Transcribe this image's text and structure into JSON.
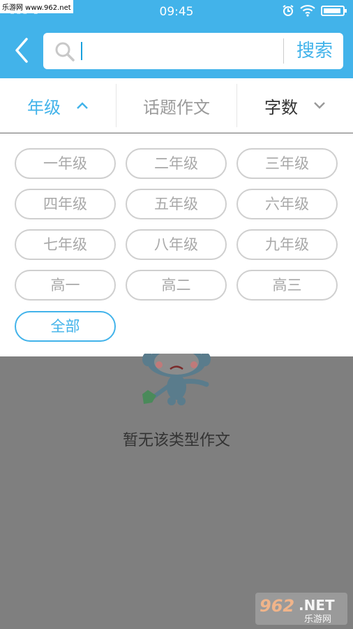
{
  "status_bar": {
    "time": "09:45",
    "signal_text": "",
    "watermark": "乐游网 www.962.net"
  },
  "header": {
    "search": {
      "placeholder": "",
      "value": "",
      "button_label": "搜索"
    }
  },
  "filter_tabs": [
    {
      "label": "年级",
      "active": true
    },
    {
      "label": "话题作文",
      "active": false
    },
    {
      "label": "字数",
      "active": false
    }
  ],
  "grades": [
    {
      "label": "一年级",
      "selected": false
    },
    {
      "label": "二年级",
      "selected": false
    },
    {
      "label": "三年级",
      "selected": false
    },
    {
      "label": "四年级",
      "selected": false
    },
    {
      "label": "五年级",
      "selected": false
    },
    {
      "label": "六年级",
      "selected": false
    },
    {
      "label": "七年级",
      "selected": false
    },
    {
      "label": "八年级",
      "selected": false
    },
    {
      "label": "九年级",
      "selected": false
    },
    {
      "label": "高一",
      "selected": false
    },
    {
      "label": "高二",
      "selected": false
    },
    {
      "label": "高三",
      "selected": false
    },
    {
      "label": "全部",
      "selected": true
    }
  ],
  "empty_state": {
    "message": "暂无该类型作文"
  },
  "watermark_br": {
    "main": "962.NET",
    "sub": "乐游网"
  },
  "colors": {
    "accent": "#42b3ea",
    "overlay": "#7f7f7f"
  }
}
